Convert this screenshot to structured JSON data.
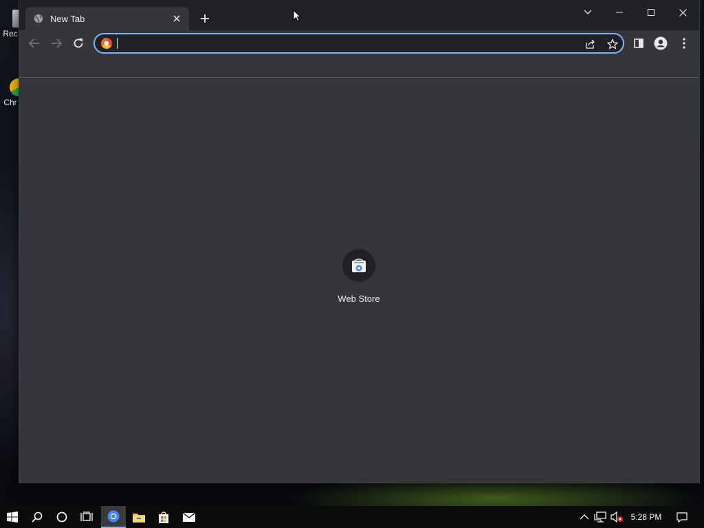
{
  "desktop": {
    "icons": [
      {
        "label": "Rec",
        "icon": "recycle-bin-icon"
      },
      {
        "label": "Chr",
        "icon": "chrome-icon"
      }
    ]
  },
  "browser": {
    "tab": {
      "title": "New Tab",
      "icon": "globe-icon"
    },
    "omnibox": {
      "value": "",
      "placeholder": ""
    },
    "shortcuts": [
      {
        "label": "Web Store",
        "icon": "web-store-icon"
      }
    ],
    "colors": {
      "frame": "#202124",
      "toolbar": "#35363a",
      "focus_ring": "#8ab4f8",
      "text": "#e8eaed"
    }
  },
  "taskbar": {
    "clock": "5:28 PM",
    "pinned": [
      "windows-start-icon",
      "search-icon",
      "cortana-icon",
      "task-view-icon",
      "chrome-icon",
      "file-explorer-icon",
      "store-icon",
      "mail-icon"
    ]
  }
}
